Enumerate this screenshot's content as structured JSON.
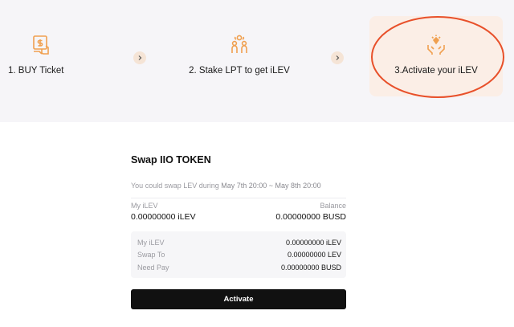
{
  "colors": {
    "accent": "#f0a050",
    "highlight_bg": "#fbeee6",
    "annotation_ring": "#e8502a",
    "button_bg": "#111111"
  },
  "steps": [
    {
      "label": "1. BUY Ticket",
      "icon": "buy-ticket-icon"
    },
    {
      "label": "2. Stake LPT to get iLEV",
      "icon": "stake-people-icon"
    },
    {
      "label": "3.Activate your iLEV",
      "icon": "activate-hands-icon"
    }
  ],
  "step_arrow_icon": "chevron-right-icon",
  "swap": {
    "title": "Swap IIO TOKEN",
    "period_prefix": "You could swap LEV during",
    "period_range": "May 7th 20:00 ~ May 8th 20:00",
    "my_ilev_label": "My iLEV",
    "balance_label": "Balance",
    "my_ilev_value": "0.00000000 iLEV",
    "balance_value": "0.00000000 BUSD",
    "details": [
      {
        "label": "My iLEV",
        "value": "0.00000000 iLEV"
      },
      {
        "label": "Swap To",
        "value": "0.00000000 LEV"
      },
      {
        "label": "Need Pay",
        "value": "0.00000000 BUSD"
      }
    ],
    "button_label": "Activate"
  }
}
